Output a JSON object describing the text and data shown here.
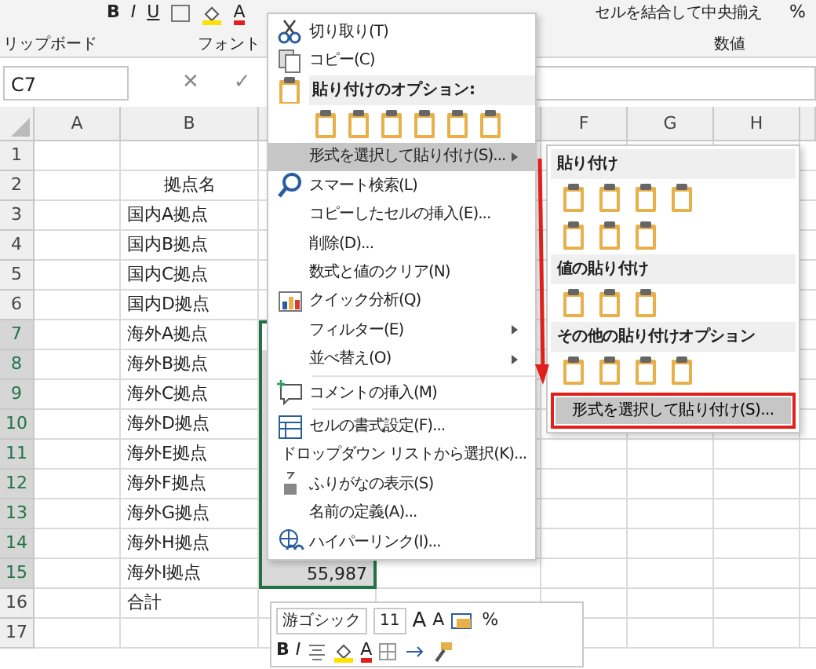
{
  "ribbon": {
    "font_buttons": [
      "B",
      "I",
      "U"
    ],
    "font_color": "A",
    "merge": "セルを結合して中央揃え",
    "percent": "%",
    "groups": [
      {
        "label": "リップボード"
      },
      {
        "label": "フォント"
      },
      {
        "label": "数値"
      }
    ]
  },
  "formula_bar": {
    "name_box": "C7",
    "cancel": "✕",
    "enter": "✓"
  },
  "columns": [
    "A",
    "B",
    "F",
    "G",
    "H"
  ],
  "rows": [
    {
      "row": "1",
      "b": "",
      "c": "",
      "selected": false
    },
    {
      "row": "2",
      "b": "拠点名",
      "c": "",
      "selected": false
    },
    {
      "row": "3",
      "b": "国内A拠点",
      "c": "",
      "selected": false
    },
    {
      "row": "4",
      "b": "国内B拠点",
      "c": "",
      "selected": false
    },
    {
      "row": "5",
      "b": "国内C拠点",
      "c": "",
      "selected": false
    },
    {
      "row": "6",
      "b": "国内D拠点",
      "c": "",
      "selected": false
    },
    {
      "row": "7",
      "b": "海外A拠点",
      "c": "",
      "selected": true
    },
    {
      "row": "8",
      "b": "海外B拠点",
      "c": "",
      "selected": true
    },
    {
      "row": "9",
      "b": "海外C拠点",
      "c": "",
      "selected": true
    },
    {
      "row": "10",
      "b": "海外D拠点",
      "c": "",
      "selected": true
    },
    {
      "row": "11",
      "b": "海外E拠点",
      "c": "",
      "selected": true
    },
    {
      "row": "12",
      "b": "海外F拠点",
      "c": "",
      "selected": true
    },
    {
      "row": "13",
      "b": "海外G拠点",
      "c": "",
      "selected": true
    },
    {
      "row": "14",
      "b": "海外H拠点",
      "c": "",
      "selected": true
    },
    {
      "row": "15",
      "b": "海外I拠点",
      "c": "55,987",
      "selected": true
    },
    {
      "row": "16",
      "b": "合計",
      "c": "",
      "selected": false
    },
    {
      "row": "17",
      "b": "",
      "c": "",
      "selected": false
    }
  ],
  "context_menu": [
    {
      "kind": "item",
      "label": "切り取り(T)",
      "submenu": false,
      "selected": false
    },
    {
      "kind": "item",
      "label": "コピー(C)",
      "submenu": false,
      "selected": false
    },
    {
      "kind": "header",
      "label": "貼り付けのオプション:"
    },
    {
      "kind": "paste-icons"
    },
    {
      "kind": "item",
      "label": "形式を選択して貼り付け(S)...",
      "submenu": true,
      "selected": true
    },
    {
      "kind": "item",
      "label": "スマート検索(L)",
      "submenu": false,
      "selected": false
    },
    {
      "kind": "item",
      "label": "コピーしたセルの挿入(E)...",
      "submenu": false,
      "selected": false
    },
    {
      "kind": "item",
      "label": "削除(D)...",
      "submenu": false,
      "selected": false
    },
    {
      "kind": "item",
      "label": "数式と値のクリア(N)",
      "submenu": false,
      "selected": false
    },
    {
      "kind": "item",
      "label": "クイック分析(Q)",
      "submenu": false,
      "selected": false
    },
    {
      "kind": "item",
      "label": "フィルター(E)",
      "submenu": true,
      "selected": false
    },
    {
      "kind": "item",
      "label": "並べ替え(O)",
      "submenu": true,
      "selected": false
    },
    {
      "kind": "item",
      "label": "コメントの挿入(M)",
      "submenu": false,
      "selected": false
    },
    {
      "kind": "item",
      "label": "セルの書式設定(F)...",
      "submenu": false,
      "selected": false
    },
    {
      "kind": "item",
      "label": "ドロップダウン リストから選択(K)...",
      "submenu": false,
      "selected": false
    },
    {
      "kind": "item",
      "label": "ふりがなの表示(S)",
      "submenu": false,
      "selected": false
    },
    {
      "kind": "item",
      "label": "名前の定義(A)...",
      "submenu": false,
      "selected": false
    },
    {
      "kind": "item",
      "label": "ハイパーリンク(I)...",
      "submenu": false,
      "selected": false
    }
  ],
  "submenu": {
    "groups": [
      {
        "label": "貼り付け"
      },
      {
        "label": "値の貼り付け"
      },
      {
        "label": "その他の貼り付けオプション"
      }
    ],
    "button": {
      "label": "形式を選択して貼り付け(S)...",
      "selected": true
    }
  },
  "mini_toolbar": {
    "font": "游ゴシック",
    "size": "11",
    "grow": "A",
    "shrink": "A",
    "percent": "%",
    "bold": "B",
    "italic": "I",
    "font_color": "A"
  }
}
